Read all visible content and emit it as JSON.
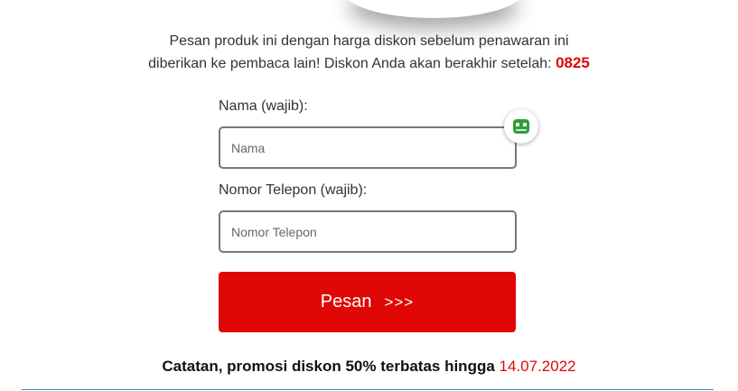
{
  "intro": {
    "line1": "Pesan produk ini dengan harga diskon sebelum penawaran ini",
    "line2": "diberikan ke pembaca lain! Diskon Anda akan berakhir setelah:",
    "timer": "0825"
  },
  "form": {
    "name_label": "Nama (wajib):",
    "name_placeholder": "Nama",
    "phone_label": "Nomor Telepon (wajib):",
    "phone_placeholder": "Nomor Telepon",
    "submit_label": "Pesan",
    "submit_arrows": ">>>"
  },
  "note": {
    "text": "Catatan, promosi diskon 50% terbatas hingga",
    "date": "14.07.2022"
  },
  "colors": {
    "accent_red": "#e00707",
    "divider_blue": "#3a8ec4",
    "badge_green": "#2e9e3a"
  },
  "icons": {
    "password_manager": "password-manager-icon"
  }
}
